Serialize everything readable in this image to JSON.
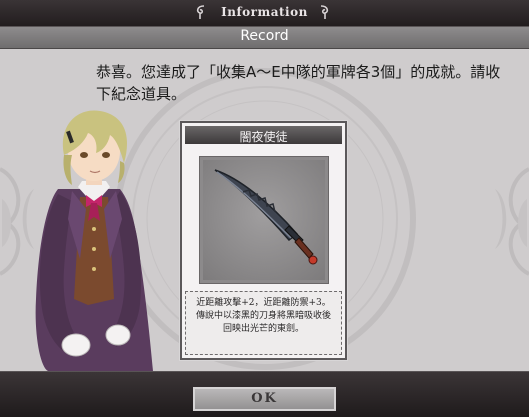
{
  "header": {
    "title": "Information"
  },
  "record_bar": {
    "label": "Record"
  },
  "message": {
    "text": "恭喜。您達成了「收集A～E中隊的軍牌各3個」的成就。請收下紀念道具。"
  },
  "item": {
    "name": "闇夜使徒",
    "description": "近距離攻擊+2，近距離防禦+3。傳說中以漆黑的刀身將黑暗吸收後回映出光芒的東劍。",
    "icon": "sword-icon"
  },
  "footer": {
    "ok_label": "OK"
  },
  "colors": {
    "panel": "#cfcccd",
    "header": "#2a2526",
    "coat": "#5a3c5e",
    "hair": "#c9c27f"
  }
}
